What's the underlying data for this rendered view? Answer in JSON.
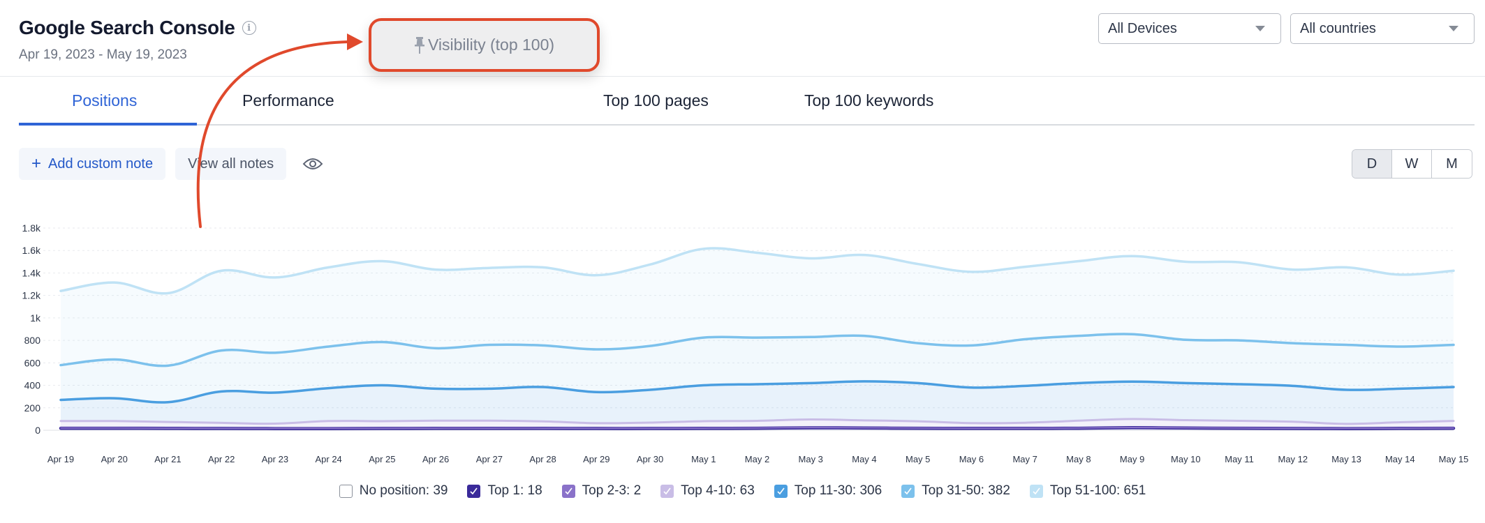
{
  "header": {
    "title": "Google Search Console",
    "info_icon": "info-circle-icon",
    "date_range": "Apr 19, 2023 - May 19, 2023",
    "devices_select": "All Devices",
    "countries_select": "All countries"
  },
  "floating_card": {
    "icon": "pin-icon",
    "label": "Visibility (top 100)",
    "highlight_color": "#e0492c"
  },
  "tabs": [
    {
      "label": "Positions",
      "active": true
    },
    {
      "label": "Performance",
      "active": false
    },
    {
      "label": "Top 100 pages",
      "active": false
    },
    {
      "label": "Top 100 keywords",
      "active": false
    }
  ],
  "notes": {
    "add_label": "Add custom note",
    "add_icon": "plus-icon",
    "view_label": "View all notes",
    "eye_icon": "eye-icon"
  },
  "granularity": {
    "options": [
      "D",
      "W",
      "M"
    ],
    "selected": "D"
  },
  "accent_color": "#2f64d6",
  "chart_data": {
    "type": "area",
    "stacked": true,
    "title": "",
    "xlabel": "",
    "ylabel": "",
    "ylim": [
      0,
      1800
    ],
    "yticks": [
      0,
      200,
      400,
      600,
      800,
      1000,
      1200,
      1400,
      1600,
      1800
    ],
    "ytick_labels": [
      "0",
      "200",
      "400",
      "600",
      "800",
      "1k",
      "1.2k",
      "1.4k",
      "1.6k",
      "1.8k"
    ],
    "grid": true,
    "legend_position": "bottom",
    "x": [
      "Apr 19",
      "Apr 20",
      "Apr 21",
      "Apr 22",
      "Apr 23",
      "Apr 24",
      "Apr 25",
      "Apr 26",
      "Apr 27",
      "Apr 28",
      "Apr 29",
      "Apr 30",
      "May 1",
      "May 2",
      "May 3",
      "May 4",
      "May 5",
      "May 6",
      "May 7",
      "May 8",
      "May 9",
      "May 10",
      "May 11",
      "May 12",
      "May 13",
      "May 14",
      "May 15"
    ],
    "series": [
      {
        "name": "No position",
        "legend_value": 39,
        "visible": false,
        "color": "#ffffff",
        "values": [
          39,
          39,
          39,
          39,
          39,
          39,
          39,
          39,
          39,
          39,
          39,
          39,
          39,
          39,
          39,
          39,
          39,
          39,
          39,
          39,
          39,
          39,
          39,
          39,
          39,
          39,
          39
        ]
      },
      {
        "name": "Top 1",
        "legend_value": 18,
        "visible": true,
        "color": "#3a2a9a",
        "values": [
          18,
          18,
          17,
          16,
          15,
          15,
          16,
          17,
          17,
          17,
          16,
          16,
          17,
          18,
          22,
          20,
          18,
          17,
          17,
          18,
          23,
          20,
          18,
          16,
          15,
          17,
          18
        ]
      },
      {
        "name": "Top 2-3",
        "legend_value": 2,
        "visible": true,
        "color": "#8a72c9",
        "values": [
          2,
          2,
          2,
          2,
          2,
          2,
          2,
          2,
          2,
          2,
          2,
          2,
          2,
          2,
          2,
          2,
          2,
          2,
          2,
          2,
          2,
          2,
          2,
          2,
          2,
          2,
          2
        ]
      },
      {
        "name": "Top 4-10",
        "legend_value": 63,
        "visible": true,
        "color": "#c9bde6",
        "values": [
          62,
          62,
          55,
          48,
          42,
          65,
          63,
          66,
          66,
          60,
          45,
          50,
          62,
          64,
          72,
          66,
          60,
          45,
          48,
          65,
          75,
          68,
          64,
          58,
          40,
          52,
          63
        ]
      },
      {
        "name": "Top 11-30",
        "legend_value": 306,
        "visible": true,
        "color": "#4a9ee0",
        "values": [
          188,
          203,
          176,
          279,
          276,
          293,
          319,
          285,
          285,
          306,
          277,
          292,
          319,
          326,
          324,
          347,
          340,
          316,
          328,
          335,
          333,
          330,
          326,
          319,
          303,
          299,
          302
        ]
      },
      {
        "name": "Top 31-50",
        "legend_value": 382,
        "visible": true,
        "color": "#7cc1ec",
        "values": [
          310,
          345,
          325,
          365,
          355,
          370,
          385,
          360,
          390,
          370,
          380,
          390,
          425,
          415,
          410,
          405,
          355,
          375,
          415,
          420,
          422,
          385,
          390,
          380,
          400,
          375,
          375
        ]
      },
      {
        "name": "Top 51-100",
        "legend_value": 651,
        "visible": true,
        "color": "#bfe2f5",
        "values": [
          660,
          685,
          645,
          710,
          670,
          705,
          720,
          700,
          685,
          695,
          660,
          725,
          790,
          755,
          700,
          720,
          705,
          655,
          645,
          665,
          695,
          695,
          695,
          655,
          690,
          640,
          660
        ]
      }
    ]
  }
}
